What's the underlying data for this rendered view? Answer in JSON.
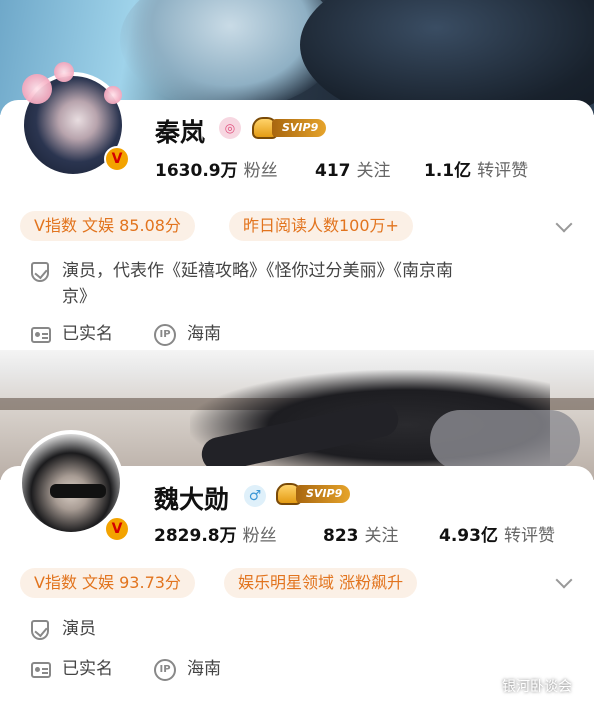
{
  "profiles": [
    {
      "name": "秦岚",
      "followers": "1630.9万",
      "followers_label": "粉丝",
      "following": "417",
      "following_label": "关注",
      "engagement": "1.1亿",
      "engagement_label": "转评赞",
      "svip": "SVIP9",
      "v_index": "V指数 文娱 85.08分",
      "highlight": "昨日阅读人数100万+",
      "bio_line1": "演员，代表作《延禧攻略》《怪你过分美丽》《南京南",
      "bio_line2": "京》",
      "verified": "已实名",
      "ip_location": "海南"
    },
    {
      "name": "魏大勋",
      "followers": "2829.8万",
      "followers_label": "粉丝",
      "following": "823",
      "following_label": "关注",
      "engagement": "4.93亿",
      "engagement_label": "转评赞",
      "svip": "SVIP9",
      "v_index": "V指数 文娱 93.73分",
      "highlight": "娱乐明星领域 涨粉飙升",
      "bio_line1": "演员",
      "verified": "已实名",
      "ip_location": "海南"
    }
  ],
  "icons": {
    "verified_badge": "V",
    "ip_icon": "IP",
    "gender_icon": "♂",
    "badge1_icon": "◎"
  },
  "watermark": "银河卧谈会",
  "colors": {
    "accent_orange": "#e2741e",
    "pill_bg": "#fbf0e6",
    "vip_gold": "#e6a42b"
  }
}
